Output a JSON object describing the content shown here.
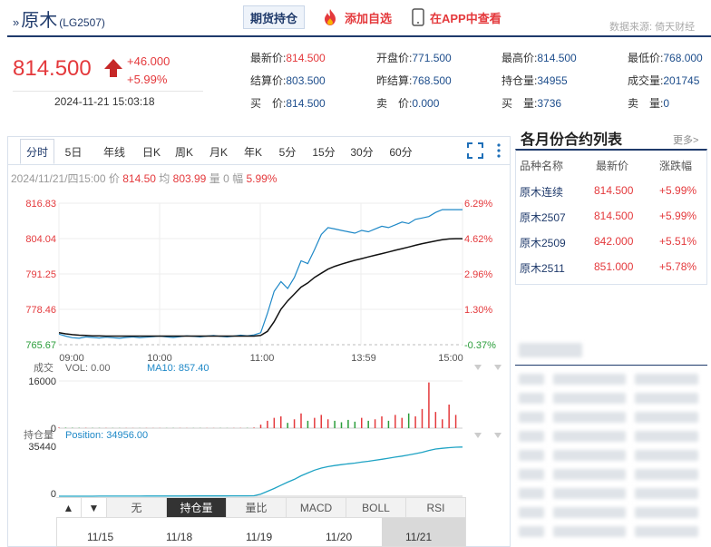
{
  "header": {
    "title": "原木",
    "code": "(LG2507)",
    "holdings_label": "期货持仓",
    "add_fav_label": "添加自选",
    "app_label": "在APP中查看",
    "source": "数据来源: 倚天财经"
  },
  "quote": {
    "price": "814.500",
    "change": "+46.000",
    "change_pct": "+5.99%",
    "time": "2024-11-21 15:03:18"
  },
  "stats": [
    {
      "label": "最新价:",
      "value": "814.500",
      "red": true
    },
    {
      "label": "开盘价:",
      "value": "771.500"
    },
    {
      "label": "最高价:",
      "value": "814.500"
    },
    {
      "label": "最低价:",
      "value": "768.000"
    },
    {
      "label": "结算价:",
      "value": "803.500"
    },
    {
      "label": "昨结算:",
      "value": "768.500"
    },
    {
      "label": "持仓量:",
      "value": "34955"
    },
    {
      "label": "成交量:",
      "value": "201745"
    },
    {
      "label": "买　价:",
      "value": "814.500"
    },
    {
      "label": "卖　价:",
      "value": "0.000"
    },
    {
      "label": "买　量:",
      "value": "3736"
    },
    {
      "label": "卖　量:",
      "value": "0"
    }
  ],
  "tabs": [
    "分时",
    "5日",
    "年线",
    "日K",
    "周K",
    "月K",
    "年K",
    "5分",
    "15分",
    "30分",
    "60分"
  ],
  "info": {
    "date": "2024/11/21/四15:00",
    "price_label": "价",
    "price": "814.50",
    "avg_label": "均",
    "avg": "803.99",
    "vol_label": "量",
    "vol": "0",
    "amp_label": "幅",
    "amp": "5.99%"
  },
  "chart_data": {
    "type": "line",
    "price_axis": [
      "816.83",
      "804.04",
      "791.25",
      "778.46",
      "765.67"
    ],
    "pct_axis": [
      "6.29%",
      "4.62%",
      "2.96%",
      "1.30%",
      "-0.37%"
    ],
    "ylim": [
      765.67,
      816.83
    ],
    "time_axis": [
      "09:00",
      "10:00",
      "11:00",
      "13:59",
      "15:00"
    ],
    "series": [
      {
        "values": [
          769.5,
          768.8,
          768.2,
          768.0,
          768.5,
          768.3,
          768.1,
          768.4,
          768.2,
          768.0,
          768.3,
          768.5,
          768.2,
          768.4,
          768.6,
          768.8,
          768.5,
          768.3,
          768.6,
          768.9,
          768.7,
          768.5,
          768.8,
          769.0,
          768.7,
          768.5,
          768.8,
          769.1,
          768.9,
          769.2,
          770.0,
          777.0,
          785.0,
          788.5,
          786.0,
          790.0,
          796.0,
          795.0,
          800.0,
          805.5,
          808.0,
          807.5,
          807.0,
          806.5,
          806.0,
          807.0,
          806.5,
          807.5,
          808.5,
          808.0,
          809.0,
          810.0,
          809.5,
          811.0,
          811.5,
          812.0,
          813.5,
          814.5,
          814.5,
          814.5,
          814.5
        ]
      },
      {
        "values": [
          770.0,
          769.6,
          769.3,
          769.1,
          769.0,
          768.9,
          768.9,
          768.8,
          768.8,
          768.8,
          768.8,
          768.8,
          768.8,
          768.8,
          768.8,
          768.8,
          768.8,
          768.8,
          768.8,
          768.8,
          768.8,
          768.8,
          768.8,
          768.8,
          768.8,
          768.8,
          768.8,
          768.8,
          768.8,
          768.8,
          769.0,
          770.5,
          774.0,
          778.5,
          781.5,
          784.0,
          786.5,
          788.0,
          790.0,
          791.5,
          793.0,
          794.0,
          794.8,
          795.5,
          796.2,
          796.8,
          797.4,
          798.0,
          798.6,
          799.2,
          799.8,
          800.4,
          801.0,
          801.6,
          802.2,
          802.7,
          803.2,
          803.6,
          803.9,
          804.0,
          803.99
        ]
      }
    ],
    "volume": {
      "label": "成交",
      "vol_text": "VOL: 0.00",
      "ma_text": "MA10: 857.40",
      "axis": [
        "16000",
        "0"
      ],
      "max": 16000,
      "values": [
        200,
        150,
        120,
        100,
        90,
        80,
        80,
        70,
        60,
        60,
        60,
        50,
        50,
        60,
        50,
        50,
        50,
        60,
        60,
        50,
        50,
        60,
        50,
        50,
        60,
        50,
        60,
        70,
        80,
        200,
        1200,
        2500,
        3500,
        4000,
        1800,
        3000,
        5000,
        2500,
        3500,
        4500,
        3000,
        2500,
        2000,
        2800,
        2200,
        3500,
        2500,
        3000,
        4000,
        2500,
        4500,
        3500,
        5000,
        4000,
        6500,
        15500,
        5500,
        3000,
        8000,
        4500,
        0
      ]
    },
    "position": {
      "label": "持仓量",
      "text": "Position: 34956.00",
      "axis": [
        "35440",
        "0"
      ],
      "max": 35440,
      "values": [
        5,
        10,
        15,
        20,
        25,
        30,
        35,
        40,
        50,
        60,
        70,
        80,
        90,
        100,
        110,
        120,
        130,
        140,
        150,
        160,
        170,
        180,
        190,
        200,
        210,
        220,
        230,
        240,
        250,
        300,
        1500,
        3500,
        5500,
        7800,
        10000,
        12000,
        14500,
        16500,
        18500,
        20000,
        21000,
        21800,
        22400,
        23000,
        23500,
        24200,
        24800,
        25500,
        26200,
        27000,
        27800,
        28500,
        29300,
        30200,
        31200,
        32500,
        33500,
        34000,
        34500,
        34800,
        34956
      ]
    }
  },
  "indicators": [
    "无",
    "持仓量",
    "量比",
    "MACD",
    "BOLL",
    "RSI"
  ],
  "dates": [
    "11/15",
    "11/18",
    "11/19",
    "11/20",
    "11/21"
  ],
  "right_panel": {
    "title": "各月份合约列表",
    "more": "更多>",
    "headers": [
      "品种名称",
      "最新价",
      "涨跌幅"
    ],
    "rows": [
      {
        "name": "原木连续",
        "price": "814.500",
        "pct": "+5.99%"
      },
      {
        "name": "原木2507",
        "price": "814.500",
        "pct": "+5.99%"
      },
      {
        "name": "原木2509",
        "price": "842.000",
        "pct": "+5.51%"
      },
      {
        "name": "原木2511",
        "price": "851.000",
        "pct": "+5.78%"
      }
    ]
  }
}
